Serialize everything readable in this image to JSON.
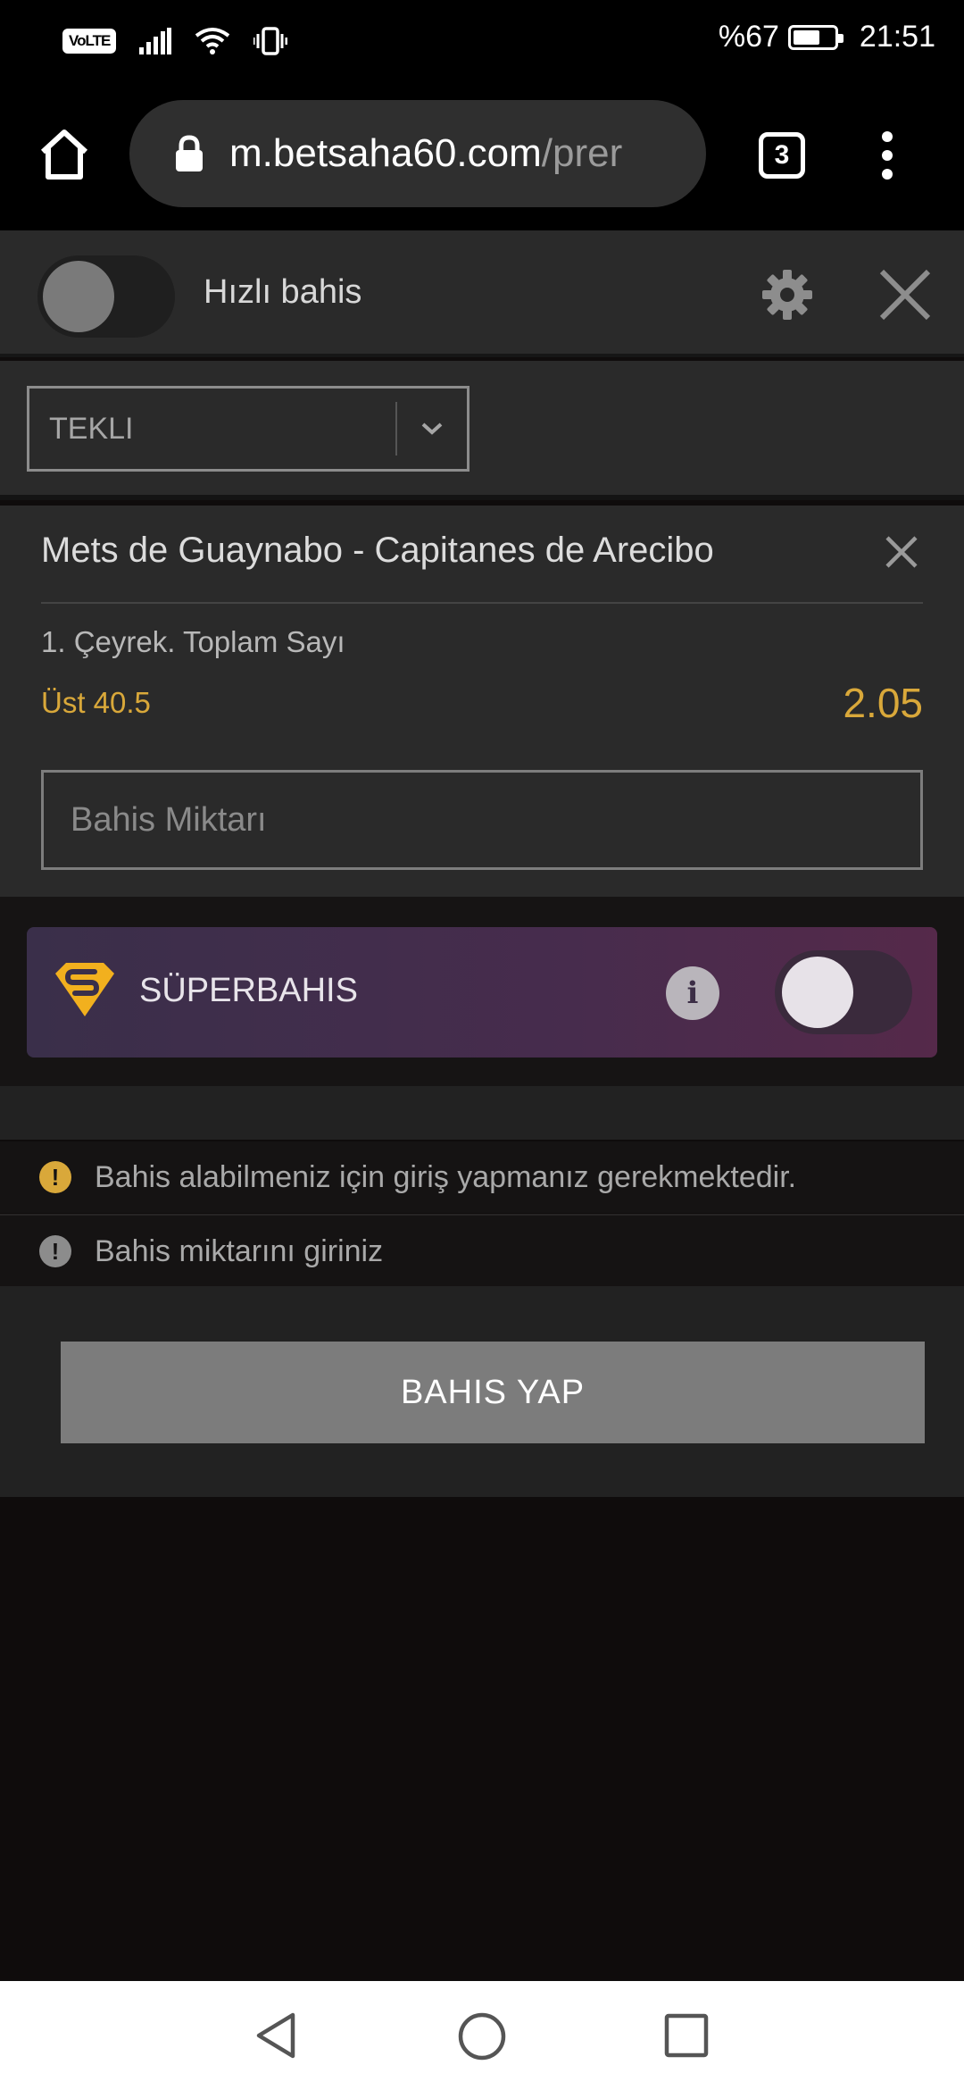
{
  "status_bar": {
    "volte": "VoLTE",
    "battery_text": "%67",
    "battery_level": 0.67,
    "time": "21:51"
  },
  "browser": {
    "url_host": "m.betsaha60.com",
    "url_path": "/prer",
    "tab_count": "3"
  },
  "quick_bet": {
    "label": "Hızlı bahis",
    "enabled": false
  },
  "bet_type": {
    "selected": "TEKLI"
  },
  "bet": {
    "match": "Mets de Guaynabo - Capitanes de Arecibo",
    "market": "1. Çeyrek. Toplam Sayı",
    "selection": "Üst 40.5",
    "odds": "2.05",
    "stake_placeholder": "Bahis Miktarı"
  },
  "superbet": {
    "label": "SÜPERBAHIS",
    "enabled": false
  },
  "warnings": [
    {
      "text": "Bahis alabilmeniz için giriş yapmanız gerekmektedir.",
      "color": "#d9a83a"
    },
    {
      "text": "Bahis miktarını giriniz",
      "color": "#8c8c8c"
    }
  ],
  "place_bet": {
    "label": "BAHIS YAP"
  },
  "colors": {
    "accent_gold": "#d9a83a",
    "panel": "#2a2a2a",
    "background": "#0f0c0c"
  }
}
